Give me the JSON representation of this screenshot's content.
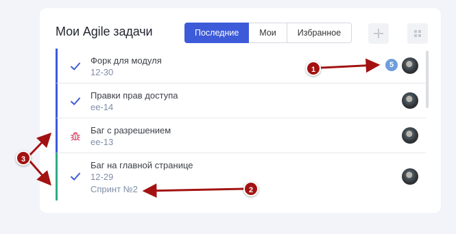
{
  "widget": {
    "title": "Мои Agile задачи",
    "tabs": [
      {
        "label": "Последние",
        "active": true
      },
      {
        "label": "Мои",
        "active": false
      },
      {
        "label": "Избранное",
        "active": false
      }
    ],
    "add_button_icon": "plus-icon",
    "layout_button_icon": "grid-icon"
  },
  "tasks": [
    {
      "title": "Форк для модуля",
      "key": "12-30",
      "sprint": "",
      "icon": "check-icon",
      "badge": "5",
      "stripe_color": "#3d5bd9"
    },
    {
      "title": "Правки прав доступа",
      "key": "ee-14",
      "sprint": "",
      "icon": "check-icon",
      "badge": "",
      "stripe_color": "#3d5bd9"
    },
    {
      "title": "Баг с разрешением",
      "key": "ee-13",
      "sprint": "",
      "icon": "bug-icon",
      "badge": "",
      "stripe_color": "#3d5bd9"
    },
    {
      "title": "Баг на главной странице",
      "key": "12-29",
      "sprint": "Спринт №2",
      "icon": "check-icon",
      "badge": "",
      "stripe_color": "#2eaa84"
    }
  ],
  "annotations": {
    "one": "1",
    "two": "2",
    "three": "3"
  },
  "colors": {
    "accent": "#3d5bd9",
    "annotation": "#a31212",
    "bug": "#e0607e",
    "done_stripe": "#2eaa84"
  }
}
